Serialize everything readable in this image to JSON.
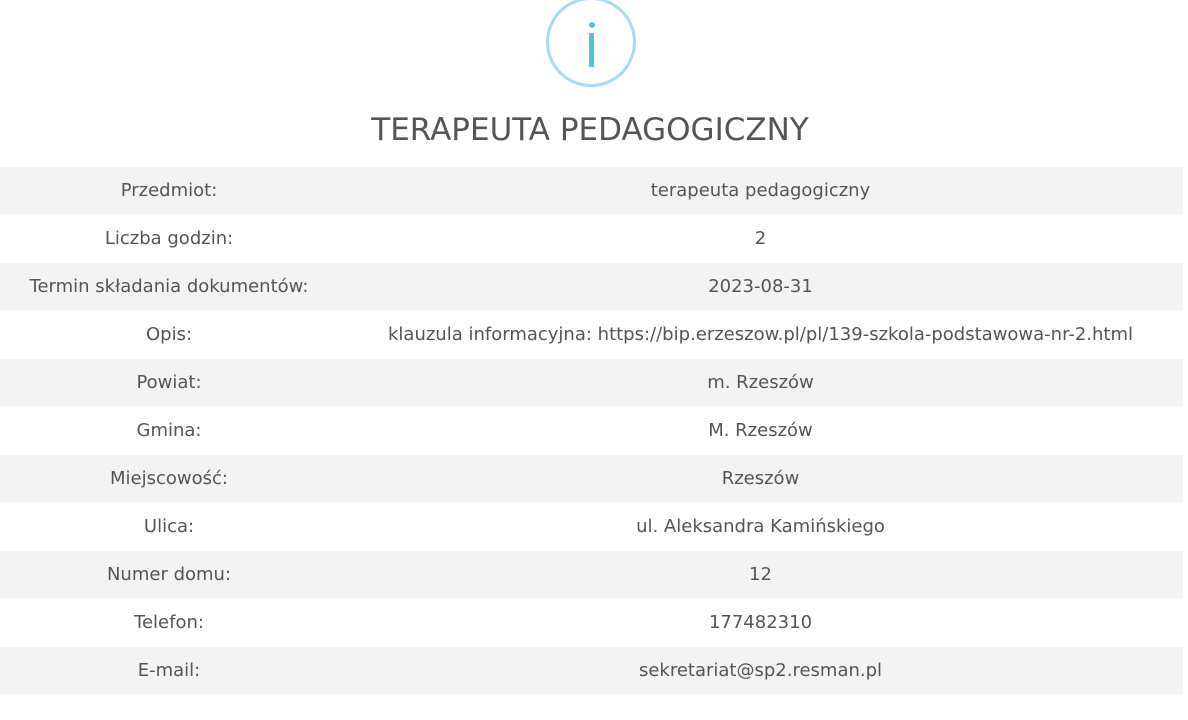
{
  "header": {
    "icon": "info-icon",
    "title": "TERAPEUTA PEDAGOGICZNY"
  },
  "details": {
    "rows": [
      {
        "label": "Przedmiot:",
        "value": "terapeuta pedagogiczny"
      },
      {
        "label": "Liczba godzin:",
        "value": "2"
      },
      {
        "label": "Termin składania dokumentów:",
        "value": "2023-08-31"
      },
      {
        "label": "Opis:",
        "value": "klauzula informacyjna: https://bip.erzeszow.pl/pl/139-szkola-podstawowa-nr-2.html"
      },
      {
        "label": "Powiat:",
        "value": "m. Rzeszów"
      },
      {
        "label": "Gmina:",
        "value": "M. Rzeszów"
      },
      {
        "label": "Miejscowość:",
        "value": "Rzeszów"
      },
      {
        "label": "Ulica:",
        "value": "ul. Aleksandra Kamińskiego"
      },
      {
        "label": "Numer domu:",
        "value": "12"
      },
      {
        "label": "Telefon:",
        "value": "177482310"
      },
      {
        "label": "E-mail:",
        "value": "sekretariat@sp2.resman.pl"
      }
    ]
  },
  "colors": {
    "icon_ring": "#a8dcec",
    "icon_glyph": "#54bfdf",
    "row_shade": "#f3f3f3",
    "text": "#555555"
  }
}
